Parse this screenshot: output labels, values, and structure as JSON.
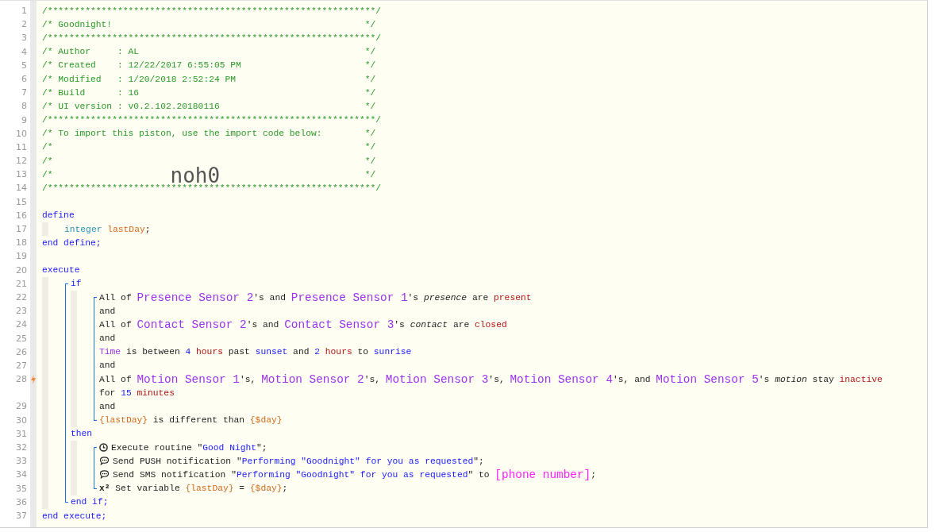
{
  "lines": [
    {
      "number": "1",
      "tokens": [
        {
          "kind": "comment",
          "text": "/************************************************************"
        },
        {
          "kind": "comment-end",
          "text": "*/"
        }
      ]
    },
    {
      "number": "2",
      "tokens": [
        {
          "kind": "comment",
          "text": "/* Goodnight!"
        },
        {
          "kind": "comment-end",
          "text": "*/"
        }
      ]
    },
    {
      "number": "3",
      "tokens": [
        {
          "kind": "comment",
          "text": "/************************************************************"
        },
        {
          "kind": "comment-end",
          "text": "*/"
        }
      ]
    },
    {
      "number": "4",
      "tokens": [
        {
          "kind": "comment",
          "text": "/* Author     : AL"
        },
        {
          "kind": "comment-end",
          "text": "*/"
        }
      ]
    },
    {
      "number": "5",
      "tokens": [
        {
          "kind": "comment",
          "text": "/* Created    : 12/22/2017 6:55:05 PM"
        },
        {
          "kind": "comment-end",
          "text": "*/"
        }
      ]
    },
    {
      "number": "6",
      "tokens": [
        {
          "kind": "comment",
          "text": "/* Modified   : 1/20/2018 2:52:24 PM"
        },
        {
          "kind": "comment-end",
          "text": "*/"
        }
      ]
    },
    {
      "number": "7",
      "tokens": [
        {
          "kind": "comment",
          "text": "/* Build      : 16"
        },
        {
          "kind": "comment-end",
          "text": "*/"
        }
      ]
    },
    {
      "number": "8",
      "tokens": [
        {
          "kind": "comment",
          "text": "/* UI version : v0.2.102.20180116"
        },
        {
          "kind": "comment-end",
          "text": "*/"
        }
      ]
    },
    {
      "number": "9",
      "tokens": [
        {
          "kind": "comment",
          "text": "/************************************************************"
        },
        {
          "kind": "comment-end",
          "text": "*/"
        }
      ]
    },
    {
      "number": "10",
      "tokens": [
        {
          "kind": "comment",
          "text": "/* To import this piston, use the import code below:"
        },
        {
          "kind": "comment-end",
          "text": "*/"
        }
      ]
    },
    {
      "number": "11",
      "tokens": [
        {
          "kind": "comment",
          "text": "/*"
        },
        {
          "kind": "comment-end",
          "text": "*/"
        }
      ]
    },
    {
      "number": "12",
      "tokens": [
        {
          "kind": "comment",
          "text": "/*"
        },
        {
          "kind": "comment-end",
          "text": "*/"
        }
      ]
    },
    {
      "number": "13",
      "tokens": [
        {
          "kind": "comment",
          "text": "/*"
        },
        {
          "kind": "import-code",
          "text": "noh0"
        },
        {
          "kind": "comment-end",
          "text": "*/"
        }
      ]
    },
    {
      "number": "14",
      "tokens": [
        {
          "kind": "comment",
          "text": "/************************************************************"
        },
        {
          "kind": "comment-end",
          "text": "*/"
        }
      ]
    },
    {
      "number": "15"
    },
    {
      "number": "16",
      "tokens": [
        {
          "kind": "keyword",
          "text": "define"
        }
      ],
      "bracket": false,
      "children": [
        {
          "number": "17",
          "tokens": [
            {
              "kind": "type",
              "text": "integer "
            },
            {
              "kind": "variable",
              "text": "lastDay"
            },
            {
              "kind": "plain",
              "text": ";"
            }
          ]
        }
      ]
    },
    {
      "number": "18",
      "tokens": [
        {
          "kind": "keyword",
          "text": "end define;"
        }
      ]
    },
    {
      "number": "19"
    },
    {
      "number": "20",
      "tokens": [
        {
          "kind": "keyword",
          "text": "execute"
        }
      ],
      "bracket": true,
      "children": [
        {
          "number": "21",
          "tokens": [
            {
              "kind": "keyword",
              "text": "if"
            }
          ],
          "bracket": true,
          "children": [
            {
              "number": "22",
              "tokens": [
                {
                  "kind": "plain",
                  "text": "All of "
                },
                {
                  "kind": "device",
                  "text": "Presence Sensor 2"
                },
                {
                  "kind": "plain",
                  "text": "'s and "
                },
                {
                  "kind": "device",
                  "text": "Presence Sensor 1"
                },
                {
                  "kind": "plain",
                  "text": "'s "
                },
                {
                  "kind": "attribute",
                  "text": "presence"
                },
                {
                  "kind": "plain",
                  "text": " are "
                },
                {
                  "kind": "value",
                  "text": "present"
                }
              ]
            },
            {
              "number": "23",
              "tokens": [
                {
                  "kind": "plain",
                  "text": "and"
                }
              ]
            },
            {
              "number": "24",
              "tokens": [
                {
                  "kind": "plain",
                  "text": "All of "
                },
                {
                  "kind": "device",
                  "text": "Contact Sensor 2"
                },
                {
                  "kind": "plain",
                  "text": "'s and "
                },
                {
                  "kind": "device",
                  "text": "Contact Sensor 3"
                },
                {
                  "kind": "plain",
                  "text": "'s "
                },
                {
                  "kind": "attribute",
                  "text": "contact"
                },
                {
                  "kind": "plain",
                  "text": " are "
                },
                {
                  "kind": "value",
                  "text": "closed"
                }
              ]
            },
            {
              "number": "25",
              "tokens": [
                {
                  "kind": "plain",
                  "text": "and"
                }
              ]
            },
            {
              "number": "26",
              "tokens": [
                {
                  "kind": "time",
                  "text": "Time"
                },
                {
                  "kind": "plain",
                  "text": " is between "
                },
                {
                  "kind": "number",
                  "text": "4 "
                },
                {
                  "kind": "value",
                  "text": "hours"
                },
                {
                  "kind": "plain",
                  "text": " past "
                },
                {
                  "kind": "constant",
                  "text": "sunset"
                },
                {
                  "kind": "plain",
                  "text": " and "
                },
                {
                  "kind": "number",
                  "text": "2 "
                },
                {
                  "kind": "value",
                  "text": "hours"
                },
                {
                  "kind": "plain",
                  "text": " to "
                },
                {
                  "kind": "constant",
                  "text": "sunrise"
                }
              ]
            },
            {
              "number": "27",
              "tokens": [
                {
                  "kind": "plain",
                  "text": "and"
                }
              ]
            },
            {
              "number": "28",
              "lightning": true,
              "tokens": [
                {
                  "kind": "plain",
                  "text": "All of "
                },
                {
                  "kind": "device",
                  "text": "Motion Sensor 1"
                },
                {
                  "kind": "plain",
                  "text": "'s, "
                },
                {
                  "kind": "device",
                  "text": "Motion Sensor 2"
                },
                {
                  "kind": "plain",
                  "text": "'s, "
                },
                {
                  "kind": "device",
                  "text": "Motion Sensor 3"
                },
                {
                  "kind": "plain",
                  "text": "'s, "
                },
                {
                  "kind": "device",
                  "text": "Motion Sensor 4"
                },
                {
                  "kind": "plain",
                  "text": "'s, and "
                },
                {
                  "kind": "device",
                  "text": "Motion Sensor 5"
                },
                {
                  "kind": "plain",
                  "text": "'s "
                },
                {
                  "kind": "attribute",
                  "text": "motion"
                },
                {
                  "kind": "plain",
                  "text": " stay "
                },
                {
                  "kind": "value",
                  "text": "inactive"
                }
              ],
              "continuation": [
                {
                  "kind": "plain",
                  "text": "for "
                },
                {
                  "kind": "number",
                  "text": "15 "
                },
                {
                  "kind": "value",
                  "text": "minutes"
                }
              ]
            },
            {
              "number": "29",
              "tokens": [
                {
                  "kind": "plain",
                  "text": "and"
                }
              ]
            },
            {
              "number": "30",
              "tokens": [
                {
                  "kind": "variable",
                  "text": "{lastDay}"
                },
                {
                  "kind": "plain",
                  "text": " is different than "
                },
                {
                  "kind": "variable",
                  "text": "{$day}"
                }
              ]
            }
          ]
        },
        {
          "number": "31",
          "tokens": [
            {
              "kind": "keyword",
              "text": "then"
            }
          ],
          "bracket": true,
          "children": [
            {
              "number": "32",
              "kind": "routine",
              "tokens": [
                {
                  "kind": "plain",
                  "text": "Execute routine \""
                },
                {
                  "kind": "string",
                  "text": "Good Night"
                },
                {
                  "kind": "plain",
                  "text": "\";"
                }
              ]
            },
            {
              "number": "33",
              "kind": "notification",
              "tokens": [
                {
                  "kind": "plain",
                  "text": "Send PUSH notification \""
                },
                {
                  "kind": "string",
                  "text": "Performing \"Goodnight\" for you as requested"
                },
                {
                  "kind": "plain",
                  "text": "\";"
                }
              ]
            },
            {
              "number": "34",
              "kind": "notification",
              "tokens": [
                {
                  "kind": "plain",
                  "text": "Send SMS notification \""
                },
                {
                  "kind": "string",
                  "text": "Performing \"Goodnight\" for you as requested"
                },
                {
                  "kind": "plain",
                  "text": "\" to "
                },
                {
                  "kind": "phone",
                  "text": "[phone number]"
                },
                {
                  "kind": "plain",
                  "text": ";"
                }
              ]
            },
            {
              "number": "35",
              "tokens": [
                {
                  "kind": "symbol",
                  "text": "x²"
                },
                {
                  "kind": "plain",
                  "text": " Set variable "
                },
                {
                  "kind": "variable",
                  "text": "{lastDay}"
                },
                {
                  "kind": "plain",
                  "text": " = "
                },
                {
                  "kind": "variable",
                  "text": "{$day}"
                },
                {
                  "kind": "plain",
                  "text": ";"
                }
              ]
            }
          ]
        },
        {
          "number": "36",
          "tokens": [
            {
              "kind": "keyword",
              "text": "end if;"
            }
          ]
        }
      ]
    },
    {
      "number": "37",
      "tokens": [
        {
          "kind": "keyword",
          "text": "end execute;"
        }
      ]
    }
  ]
}
